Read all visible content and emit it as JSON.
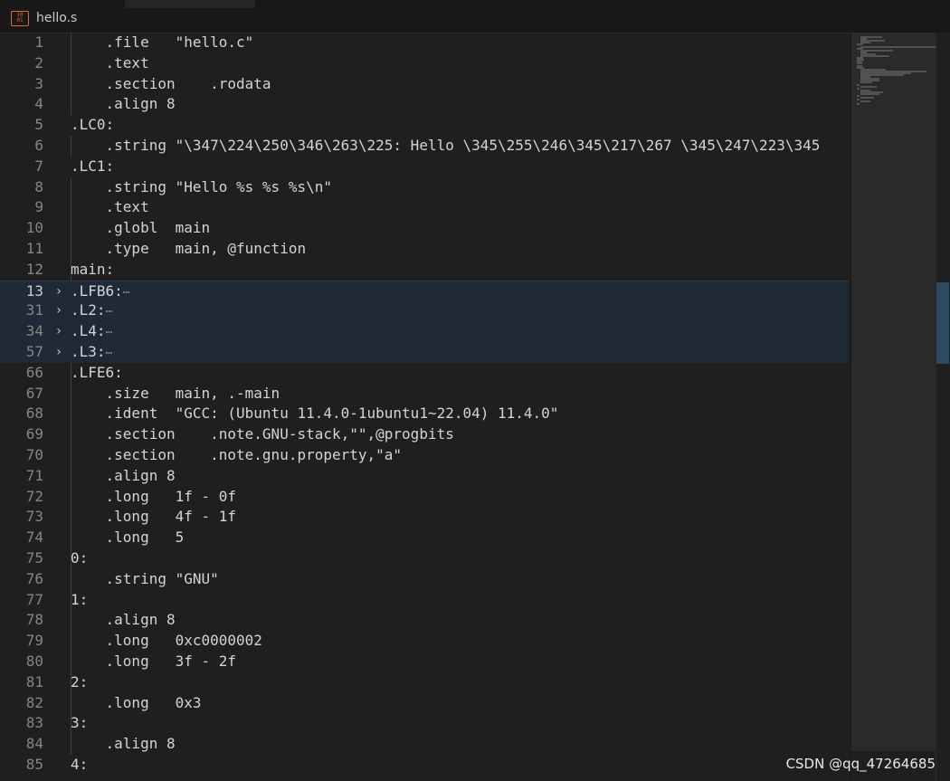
{
  "tab": {
    "filename": "hello.s",
    "icon": "asm-file-icon",
    "icon_glyph": "10\n01"
  },
  "colors": {
    "icon": "#d66b3c",
    "folded_bg": "#1f2a36",
    "editor_bg": "#1f1f1f"
  },
  "lines": [
    {
      "n": "1",
      "text": "    .file   \"hello.c\""
    },
    {
      "n": "2",
      "text": "    .text"
    },
    {
      "n": "3",
      "text": "    .section    .rodata"
    },
    {
      "n": "4",
      "text": "    .align 8"
    },
    {
      "n": "5",
      "text": ".LC0:"
    },
    {
      "n": "6",
      "text": "    .string \"\\347\\224\\250\\346\\263\\225: Hello \\345\\255\\246\\345\\217\\267 \\345\\247\\223\\345"
    },
    {
      "n": "7",
      "text": ".LC1:"
    },
    {
      "n": "8",
      "text": "    .string \"Hello %s %s %s\\n\""
    },
    {
      "n": "9",
      "text": "    .text"
    },
    {
      "n": "10",
      "text": "    .globl  main"
    },
    {
      "n": "11",
      "text": "    .type   main, @function"
    },
    {
      "n": "12",
      "text": "main:"
    },
    {
      "n": "13",
      "text": ".LFB6:",
      "folded": true,
      "active": true
    },
    {
      "n": "31",
      "text": ".L2:",
      "folded": true
    },
    {
      "n": "34",
      "text": ".L4:",
      "folded": true
    },
    {
      "n": "57",
      "text": ".L3:",
      "folded": true
    },
    {
      "n": "66",
      "text": ".LFE6:"
    },
    {
      "n": "67",
      "text": "    .size   main, .-main"
    },
    {
      "n": "68",
      "text": "    .ident  \"GCC: (Ubuntu 11.4.0-1ubuntu1~22.04) 11.4.0\""
    },
    {
      "n": "69",
      "text": "    .section    .note.GNU-stack,\"\",@progbits"
    },
    {
      "n": "70",
      "text": "    .section    .note.gnu.property,\"a\""
    },
    {
      "n": "71",
      "text": "    .align 8"
    },
    {
      "n": "72",
      "text": "    .long   1f - 0f"
    },
    {
      "n": "73",
      "text": "    .long   4f - 1f"
    },
    {
      "n": "74",
      "text": "    .long   5"
    },
    {
      "n": "75",
      "text": "0:"
    },
    {
      "n": "76",
      "text": "    .string \"GNU\""
    },
    {
      "n": "77",
      "text": "1:"
    },
    {
      "n": "78",
      "text": "    .align 8"
    },
    {
      "n": "79",
      "text": "    .long   0xc0000002"
    },
    {
      "n": "80",
      "text": "    .long   3f - 2f"
    },
    {
      "n": "81",
      "text": "2:"
    },
    {
      "n": "82",
      "text": "    .long   0x3"
    },
    {
      "n": "83",
      "text": "3:"
    },
    {
      "n": "84",
      "text": "    .align 8"
    },
    {
      "n": "85",
      "text": "4:"
    }
  ],
  "fold_glyph": "›",
  "ellipsis": "⋯",
  "watermark": "CSDN @qq_47264685"
}
